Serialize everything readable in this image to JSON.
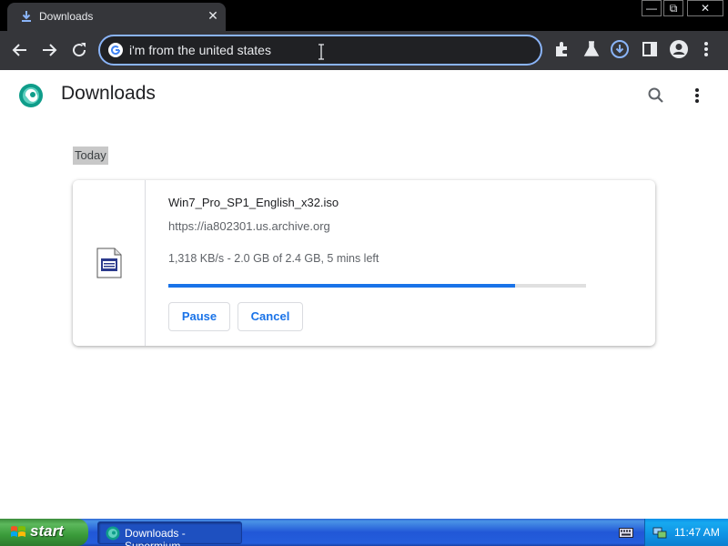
{
  "browser": {
    "tab": {
      "title": "Downloads",
      "icon": "download-icon",
      "close_glyph": "✕"
    },
    "window_controls": {
      "minimize": "—",
      "maximize": "⧉",
      "close": "✕"
    },
    "omnibox": {
      "value": "i'm from the united states",
      "icon": "google-icon"
    },
    "toolbar_icons": [
      "back-icon",
      "forward-icon",
      "reload-icon",
      "extensions-icon",
      "labs-icon",
      "downloads-icon",
      "side-panel-icon",
      "profile-icon"
    ],
    "accent_color": "#8ab4f8"
  },
  "page": {
    "title": "Downloads",
    "date_group": "Today",
    "download": {
      "file_name": "Win7_Pro_SP1_English_x32.iso",
      "url": "https://ia802301.us.archive.org",
      "status": "1,318 KB/s - 2.0 GB of 2.4 GB, 5 mins left",
      "progress": 0.83,
      "pause_label": "Pause",
      "cancel_label": "Cancel"
    },
    "accent_color": "#1a73e8"
  },
  "taskbar": {
    "start_label": "start",
    "task_label": "Downloads - Supermium",
    "clock": "11:47 AM"
  }
}
